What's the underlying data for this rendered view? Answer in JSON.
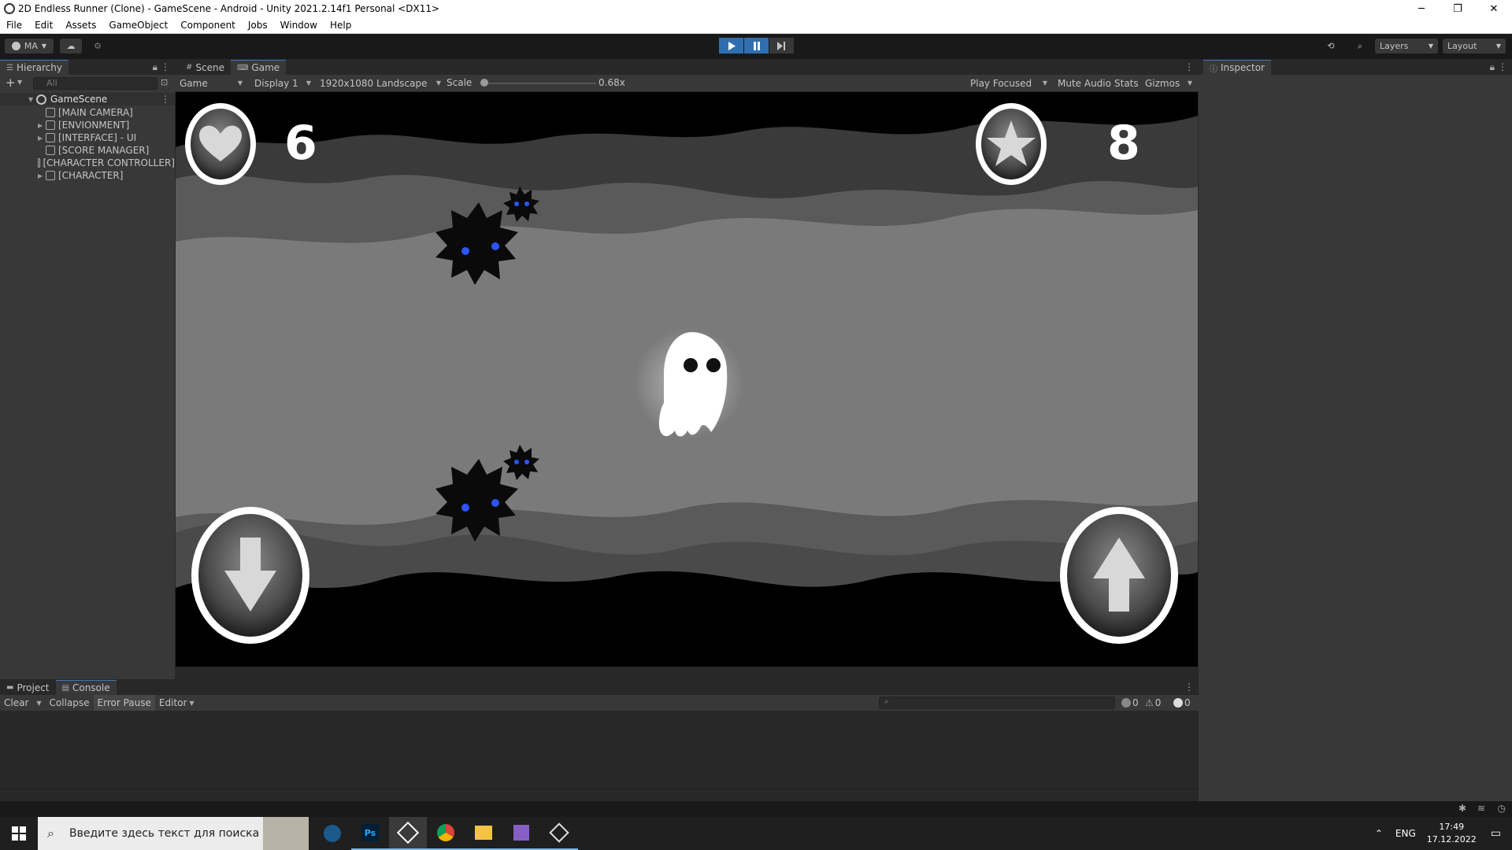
{
  "window": {
    "title": "2D Endless Runner (Clone) - GameScene - Android - Unity 2021.2.14f1 Personal <DX11>",
    "controls": [
      "─",
      "❐",
      "✕"
    ]
  },
  "menu": [
    "File",
    "Edit",
    "Assets",
    "GameObject",
    "Component",
    "Jobs",
    "Window",
    "Help"
  ],
  "toolbar": {
    "account": "MA",
    "layers": "Layers",
    "layout": "Layout"
  },
  "hierarchy": {
    "tab": "Hierarchy",
    "search_placeholder": "All",
    "add": "+",
    "scene": "GameScene",
    "items": [
      {
        "label": "[MAIN CAMERA]",
        "expandable": false
      },
      {
        "label": "[ENVIONMENT]",
        "expandable": true
      },
      {
        "label": "[INTERFACE] - UI",
        "expandable": true
      },
      {
        "label": "[SCORE MANAGER]",
        "expandable": false
      },
      {
        "label": "[CHARACTER CONTROLLER]",
        "expandable": false
      },
      {
        "label": "[CHARACTER]",
        "expandable": true
      }
    ]
  },
  "view_tabs": {
    "scene": "Scene",
    "game": "Game"
  },
  "game_toolbar": {
    "mode": "Game",
    "display": "Display 1",
    "resolution": "1920x1080 Landscape",
    "scale_label": "Scale",
    "scale_value": "0.68x",
    "scale_fraction": 0.04,
    "play_focused": "Play Focused",
    "mute": "Mute Audio",
    "stats": "Stats",
    "gizmos": "Gizmos"
  },
  "game": {
    "lives": "6",
    "stars": "8"
  },
  "inspector": {
    "tab": "Inspector"
  },
  "console": {
    "tabs": {
      "project": "Project",
      "console": "Console"
    },
    "clear": "Clear",
    "collapse": "Collapse",
    "error_pause": "Error Pause",
    "editor": "Editor",
    "log_count": "0",
    "warn_count": "0",
    "error_count": "0"
  },
  "taskbar": {
    "search_placeholder": "Введите здесь текст для поиска",
    "lang": "ENG",
    "time": "17:49",
    "date": "17.12.2022"
  },
  "colors": {
    "accent": "#3a79bb",
    "play_active": "#2f6fb0",
    "panel": "#383838",
    "panel_dark": "#282828"
  }
}
